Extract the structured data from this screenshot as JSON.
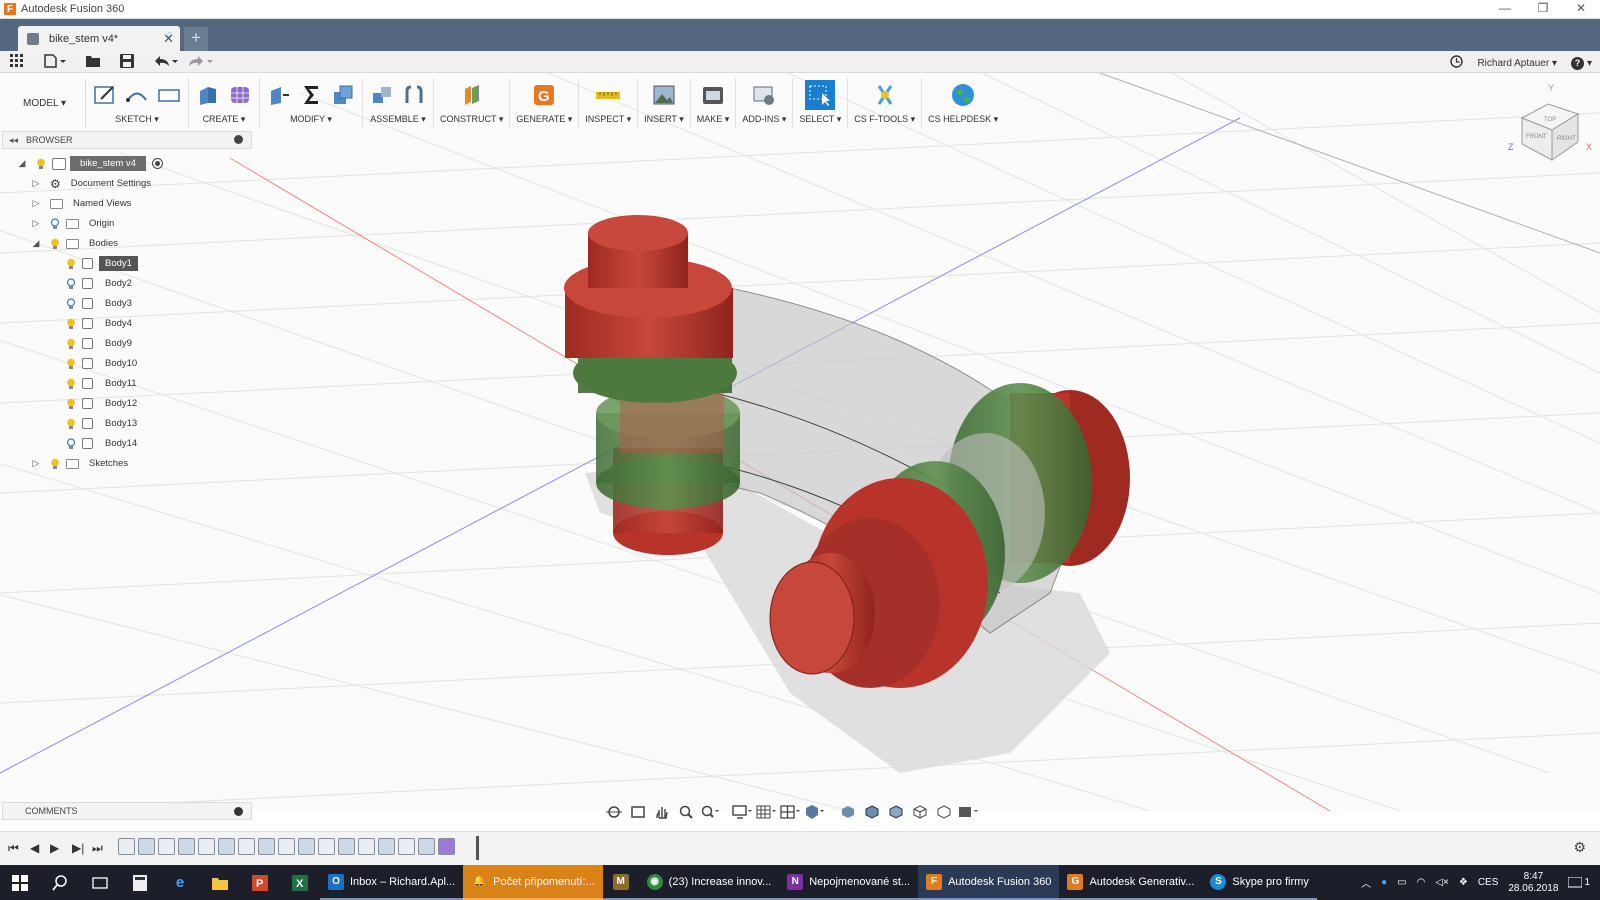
{
  "window": {
    "title": "Autodesk Fusion 360",
    "logo_letter": "F"
  },
  "tab": {
    "name": "bike_stem v4*",
    "new_tab": "+",
    "close": "✕"
  },
  "user": {
    "name": "Richard Aptauer ▾",
    "help": "?"
  },
  "toolbar": {
    "mode": "MODEL ▾",
    "groups": [
      {
        "label": "SKETCH ▾"
      },
      {
        "label": "CREATE ▾"
      },
      {
        "label": "MODIFY ▾"
      },
      {
        "label": "ASSEMBLE ▾"
      },
      {
        "label": "CONSTRUCT ▾"
      },
      {
        "label": "GENERATE ▾"
      },
      {
        "label": "INSPECT ▾"
      },
      {
        "label": "INSERT ▾"
      },
      {
        "label": "MAKE ▾"
      },
      {
        "label": "ADD-INS ▾"
      },
      {
        "label": "SELECT ▾"
      },
      {
        "label": "CS F-TOOLS ▾"
      },
      {
        "label": "CS HELPDESK ▾"
      }
    ]
  },
  "browser": {
    "title": "BROWSER",
    "root": "bike_stem v4",
    "items": [
      {
        "label": "Document Settings"
      },
      {
        "label": "Named Views"
      },
      {
        "label": "Origin"
      },
      {
        "label": "Bodies"
      },
      {
        "label": "Sketches"
      }
    ],
    "bodies": [
      "Body1",
      "Body2",
      "Body3",
      "Body4",
      "Body9",
      "Body10",
      "Body11",
      "Body12",
      "Body13",
      "Body14"
    ]
  },
  "comments": {
    "title": "COMMENTS"
  },
  "viewcube": {
    "top": "TOP",
    "front": "FRONT",
    "right": "RIGHT",
    "y": "Y",
    "z": "Z",
    "x": "X"
  },
  "taskbar": {
    "apps": [
      {
        "label": "Inbox – Richard.Apl...",
        "color": "#1f6fc5",
        "glyph": "O"
      },
      {
        "label": "Počet připomenutí:...",
        "color": "#c77a12",
        "glyph": "🔔"
      },
      {
        "label": "",
        "color": "#8b6c2a",
        "glyph": "M"
      },
      {
        "label": "(23) Increase innov...",
        "color": "#2e8b3e",
        "glyph": "◉"
      },
      {
        "label": "Nepojmenované st...",
        "color": "#7b2fa3",
        "glyph": "N"
      },
      {
        "label": "Autodesk Fusion 360",
        "color": "#e07b20",
        "glyph": "F"
      },
      {
        "label": "Autodesk Generativ...",
        "color": "#e07b20",
        "glyph": "G"
      },
      {
        "label": "Skype pro firmy",
        "color": "#1a8ad3",
        "glyph": "S"
      }
    ],
    "lang": "CES",
    "time": "8:47",
    "date": "28.06.2018",
    "notif": "1"
  },
  "colors": {
    "accent": "#54697f",
    "part_red": "#b8342b",
    "part_green": "#4c7a3e",
    "ghost": "#c8c8c8"
  }
}
